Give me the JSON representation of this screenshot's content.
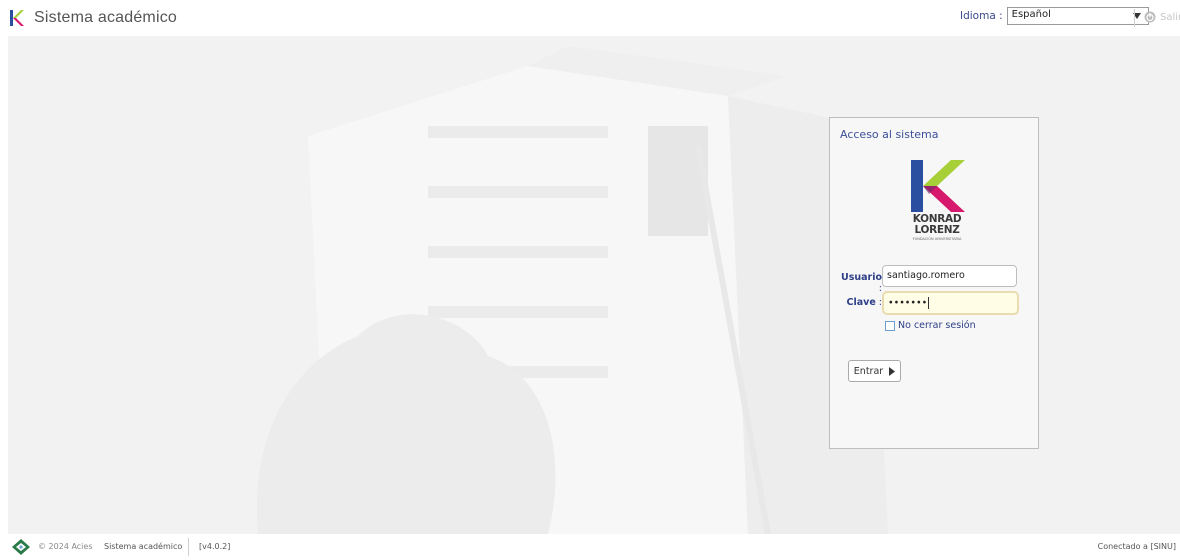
{
  "header": {
    "app_title": "Sistema académico",
    "language_label": "Idioma :",
    "language_selected": "Español",
    "exit_label": "Salir"
  },
  "login": {
    "panel_title": "Acceso al sistema",
    "logo_line1": "KONRAD",
    "logo_line2": "LORENZ",
    "logo_line3": "FUNDACIÓN UNIVERSITARIA",
    "user_label": "Usuario",
    "user_value": "santiago.romero",
    "password_label": "Clave",
    "password_value": "•••••••",
    "keep_session_label": "No cerrar sesión",
    "keep_session_checked": false,
    "submit_label": "Entrar"
  },
  "footer": {
    "copyright": "© 2024 Acies",
    "app_name": "Sistema académico",
    "version": "[v4.0.2]",
    "connection": "Conectado a [SINU]"
  },
  "colors": {
    "brand_blue": "#3c4f9a",
    "logo_green": "#a6cf38",
    "logo_magenta": "#d6196d",
    "logo_blue": "#2a4fa0"
  }
}
